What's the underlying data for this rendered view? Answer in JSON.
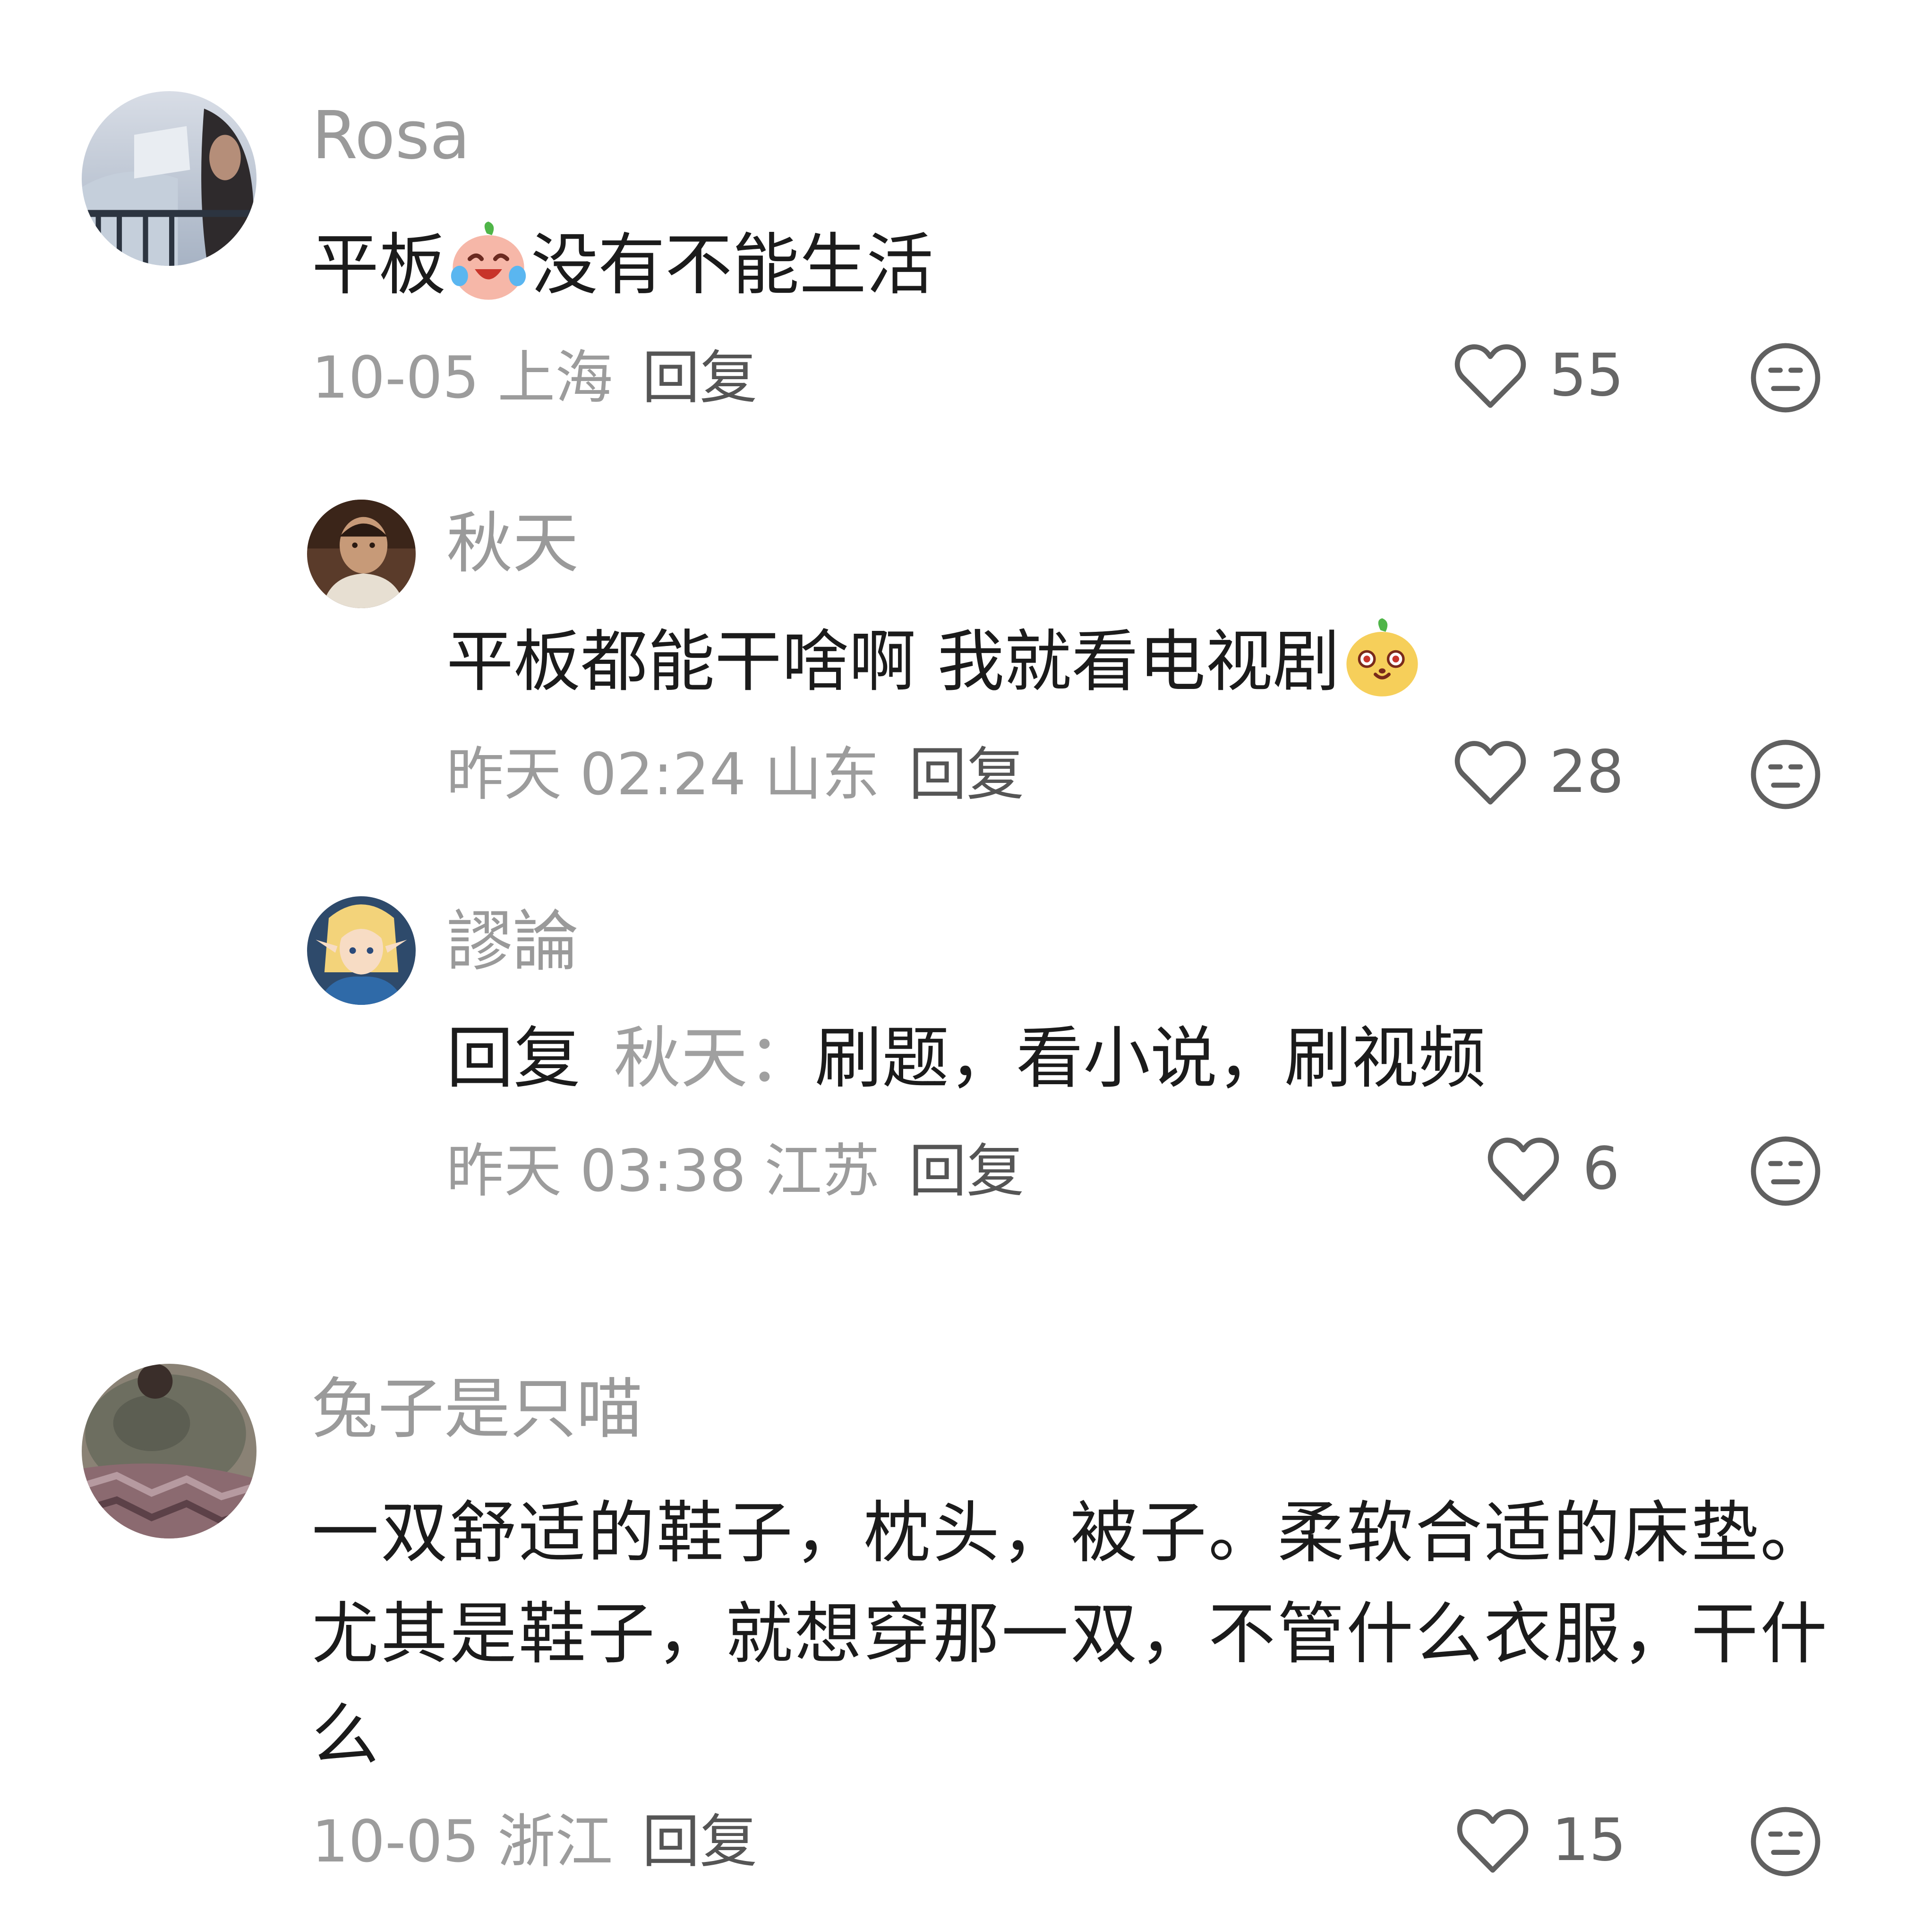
{
  "comments": [
    {
      "username": "Rosa",
      "text_before": "平板",
      "emoji": "crying-laughing-emoji",
      "text_after": "没有不能生活",
      "date_location": "10-05 上海",
      "reply_label": "回复",
      "likes": "55",
      "replies": [
        {
          "username": "秋天",
          "text_before": "平板都能干啥啊 我就看电视剧",
          "emoji": "smug-face-emoji",
          "date_location": "昨天 02:24 山东",
          "reply_label": "回复",
          "likes": "28"
        },
        {
          "username": "謬論",
          "reply_prefix": "回复",
          "reply_target": "秋天：",
          "text": "刷题，看小说，刷视频",
          "date_location": "昨天 03:38 江苏",
          "reply_label": "回复",
          "likes": "6"
        }
      ]
    },
    {
      "username": "兔子是只喵",
      "text": "一双舒适的鞋子，枕头，被子。柔软合适的床垫。尤其是鞋子，就想穿那一双，不管什么衣服，干什么",
      "date_location": "10-05 浙江",
      "reply_label": "回复",
      "likes": "15"
    }
  ],
  "colors": {
    "background": "#ffffff",
    "username": "#9a9a9a",
    "body_text": "#1b1b1b",
    "meta_text": "#9c9c9c",
    "reply_link": "#555555",
    "icon_stroke": "#606060"
  },
  "icons": [
    "heart-icon",
    "dislike-face-icon"
  ]
}
